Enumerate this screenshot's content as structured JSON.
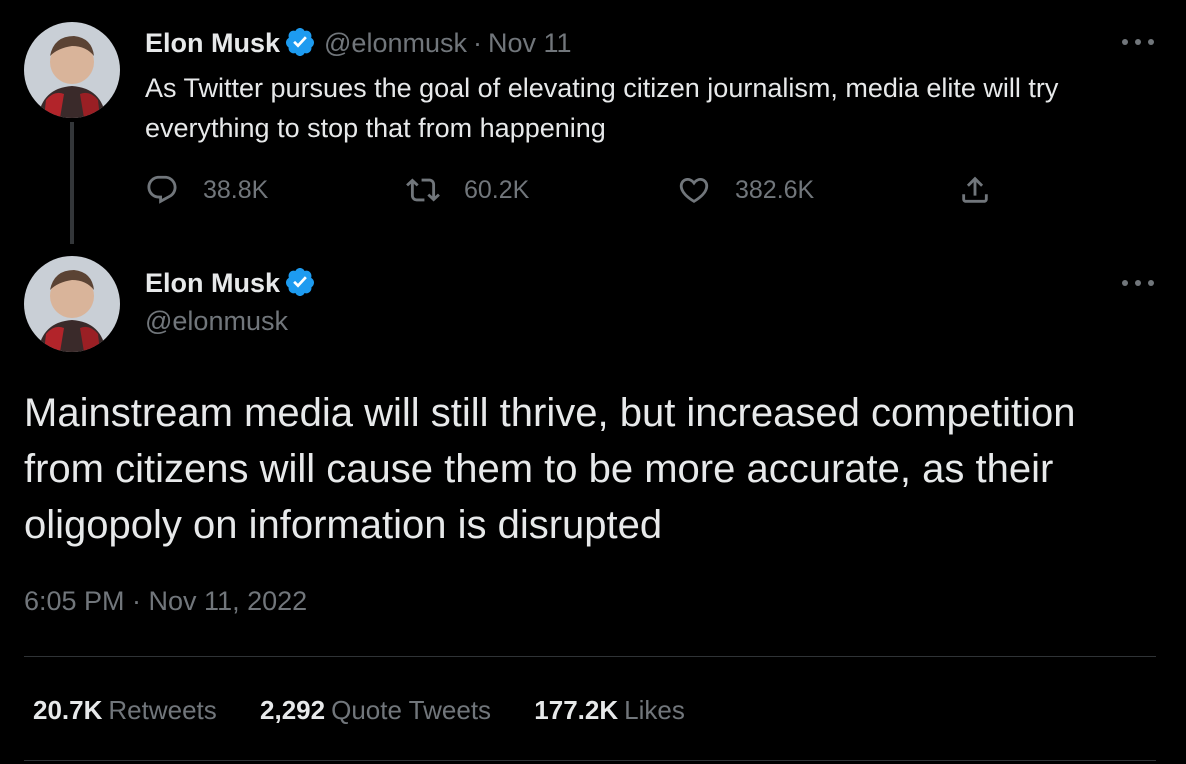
{
  "tweet1": {
    "author_name": "Elon Musk",
    "handle": "@elonmusk",
    "separator": "·",
    "date": "Nov 11",
    "text": "As Twitter pursues the goal of elevating citizen journalism, media elite will try everything to stop that from happening",
    "actions": {
      "replies": "38.8K",
      "retweets": "60.2K",
      "likes": "382.6K"
    },
    "icons": [
      "verified-badge-icon",
      "more-options-icon",
      "reply-icon",
      "retweet-icon",
      "like-icon",
      "share-icon"
    ]
  },
  "tweet2": {
    "author_name": "Elon Musk",
    "handle": "@elonmusk",
    "text": "Mainstream media will still thrive, but increased competition from citizens will cause them to be more accurate, as their oligopoly on information is disrupted",
    "timestamp": "6:05 PM · Nov 11, 2022",
    "stats": {
      "retweets_count": "20.7K",
      "retweets_label": "Retweets",
      "quotes_count": "2,292",
      "quotes_label": "Quote Tweets",
      "likes_count": "177.2K",
      "likes_label": "Likes"
    }
  },
  "colors": {
    "background": "#000000",
    "primary_text": "#e7e9ea",
    "secondary_text": "#71767b",
    "verified_badge": "#1d9bf0",
    "divider": "#2f3336"
  }
}
